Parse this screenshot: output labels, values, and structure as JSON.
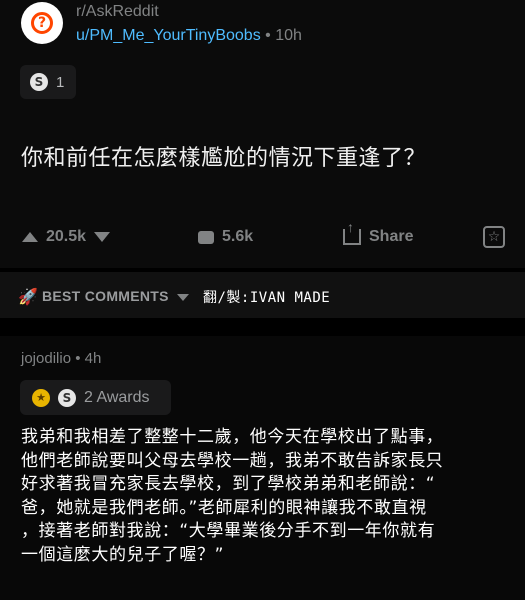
{
  "post": {
    "subreddit": "r/AskReddit",
    "username": "u/PM_Me_YourTinyBoobs",
    "age": " • 10h",
    "award_icon": "silver-award-icon",
    "award_count": "1",
    "title": "你和前任在怎麼樣尷尬的情況下重逢了？"
  },
  "actions": {
    "upvotes": "20.5k",
    "comments": "5.6k",
    "share_label": "Share"
  },
  "sort": {
    "label": "BEST COMMENTS",
    "credit": "翻/製:IVAN MADE"
  },
  "comment": {
    "username": "jojodilio",
    "age": " • 4h",
    "awards_label": "2 Awards",
    "lines": [
      "我弟和我相差了整整十二歲，他今天在學校出了點事，",
      "他們老師說要叫父母去學校一趟，我弟不敢告訴家長只",
      "好求著我冒充家長去學校，到了學校弟弟和老師說：“",
      "爸，她就是我們老師。”老師犀利的眼神讓我不敢直視",
      "，接著老師對我說：“大學畢業後分手不到一年你就有",
      "一個這麼大的兒子了喔？”"
    ]
  },
  "colors": {
    "link": "#4fbcff",
    "muted": "#818384",
    "brand": "#ff4500"
  }
}
